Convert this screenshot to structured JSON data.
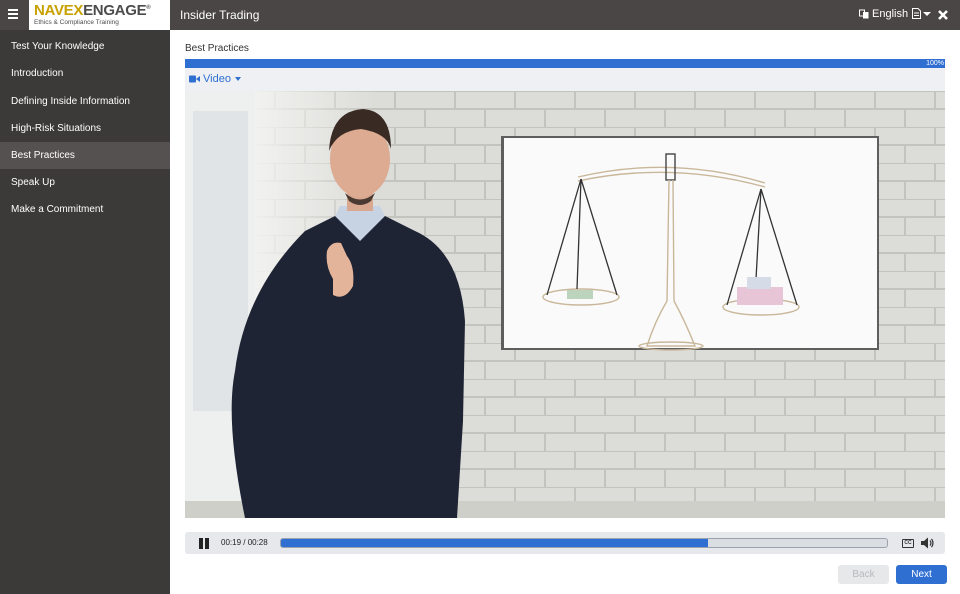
{
  "header": {
    "logo_navex": "NAVEX",
    "logo_engage": "ENGAGE",
    "logo_reg": "®",
    "logo_tagline": "Ethics & Compliance Training",
    "course_title": "Insider Trading",
    "language": "English"
  },
  "sidebar": {
    "items": [
      {
        "label": "Test Your Knowledge"
      },
      {
        "label": "Introduction"
      },
      {
        "label": "Defining Inside Information"
      },
      {
        "label": "High-Risk Situations"
      },
      {
        "label": "Best Practices",
        "active": true
      },
      {
        "label": "Speak Up"
      },
      {
        "label": "Make a Commitment"
      }
    ]
  },
  "main": {
    "section_title": "Best Practices",
    "progress_percent": 100,
    "progress_label": "100%",
    "media_tab": "Video"
  },
  "player": {
    "time": "00:19 / 00:28",
    "played_fraction": 0.705,
    "cc_label": "CC"
  },
  "footer": {
    "back_label": "Back",
    "next_label": "Next"
  },
  "colors": {
    "accent": "#2f6fd1",
    "topbar": "#4a4645",
    "sidebar": "#3c3a39",
    "sidebar_active": "#555150",
    "logo_gold": "#c8a100"
  },
  "icons": {
    "menu": "hamburger-icon",
    "language": "language-icon",
    "document": "document-icon",
    "close": "close-icon",
    "media": "video-camera-icon",
    "play_state": "pause-icon",
    "captions": "closed-captions-icon",
    "volume": "speaker-icon"
  }
}
